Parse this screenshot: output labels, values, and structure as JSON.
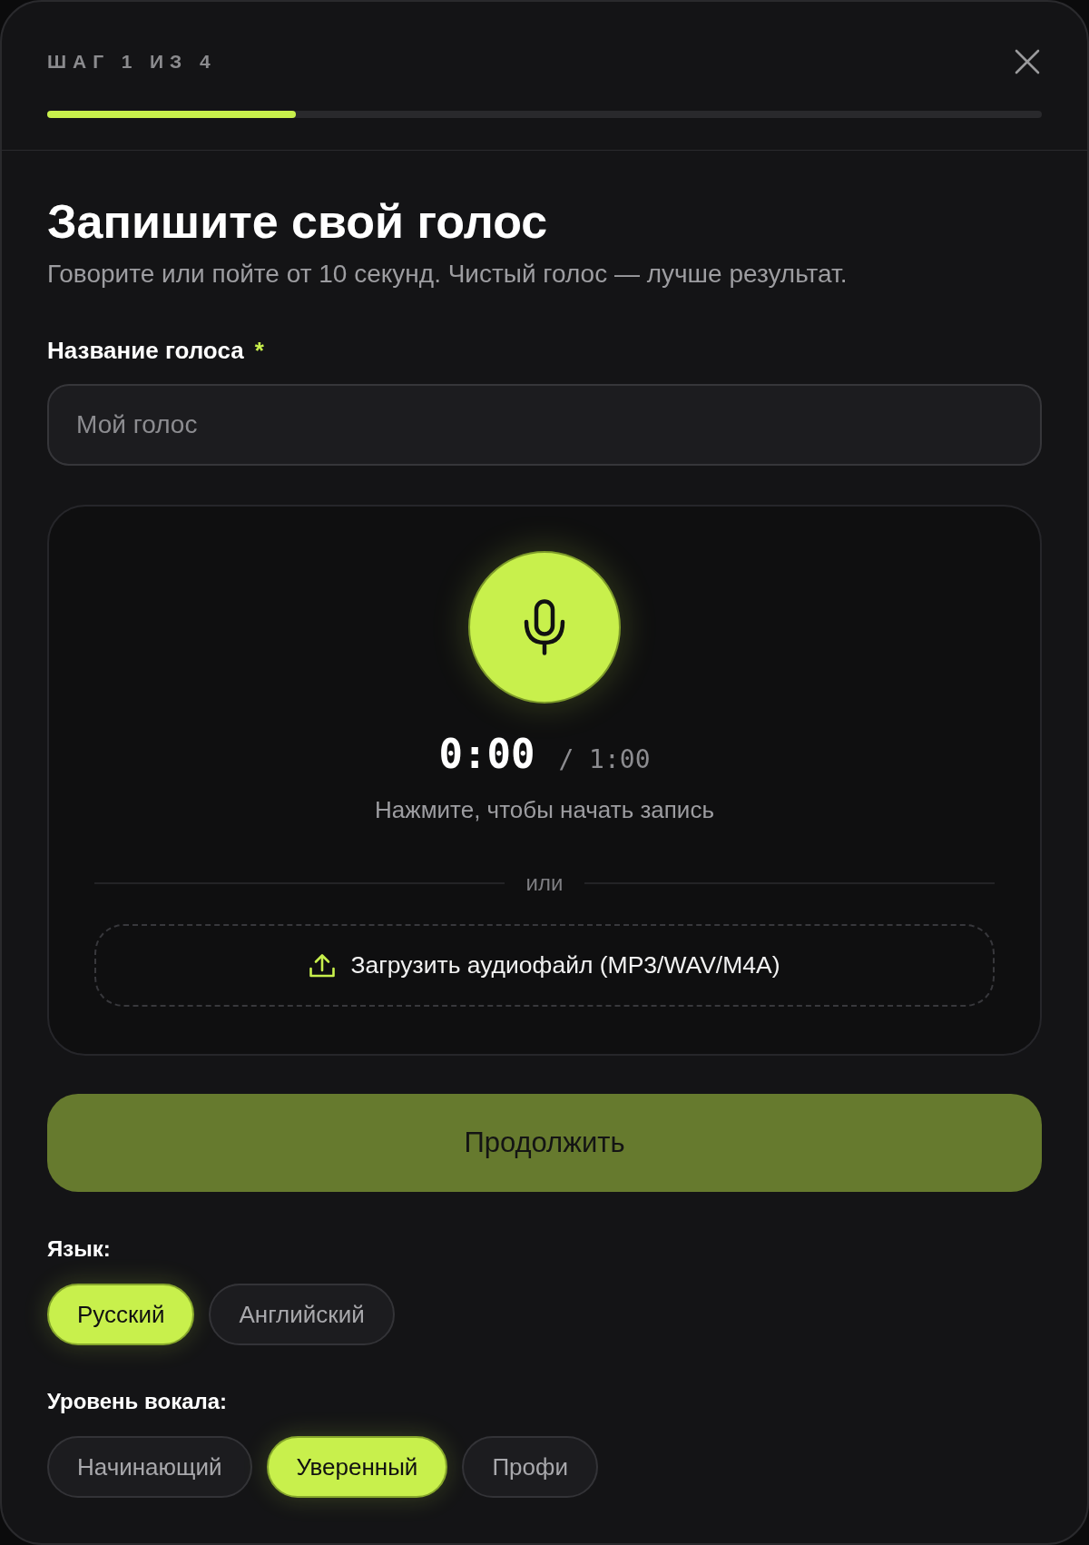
{
  "header": {
    "step": "ШАГ 1 ИЗ 4",
    "progress": {
      "level": 0.25
    }
  },
  "title": "Запишите свой голос",
  "subtitle": "Говорите или пойте от 10 секунд. Чистый голос — лучше результат.",
  "name_field": {
    "label": "Название голоса",
    "required_mark": "*",
    "placeholder": "Мой голос"
  },
  "recorder": {
    "elapsed": "0:00",
    "limit": "/ 1:00",
    "hint": "Нажмите, чтобы начать запись",
    "divider": "или",
    "upload": {
      "label": "Загрузить аудиофайл (MP3/WAV/M4A)"
    }
  },
  "continue_button": {
    "label": "Продолжить",
    "disabled": true
  },
  "language": {
    "label": "Язык:",
    "options": [
      {
        "label": "Русский",
        "selected": true
      },
      {
        "label": "Английский",
        "selected": false
      }
    ]
  },
  "vocal_level": {
    "label": "Уровень вокала:",
    "options": [
      {
        "label": "Начинающий",
        "selected": false
      },
      {
        "label": "Уверенный",
        "selected": true
      },
      {
        "label": "Профи",
        "selected": false
      }
    ]
  }
}
